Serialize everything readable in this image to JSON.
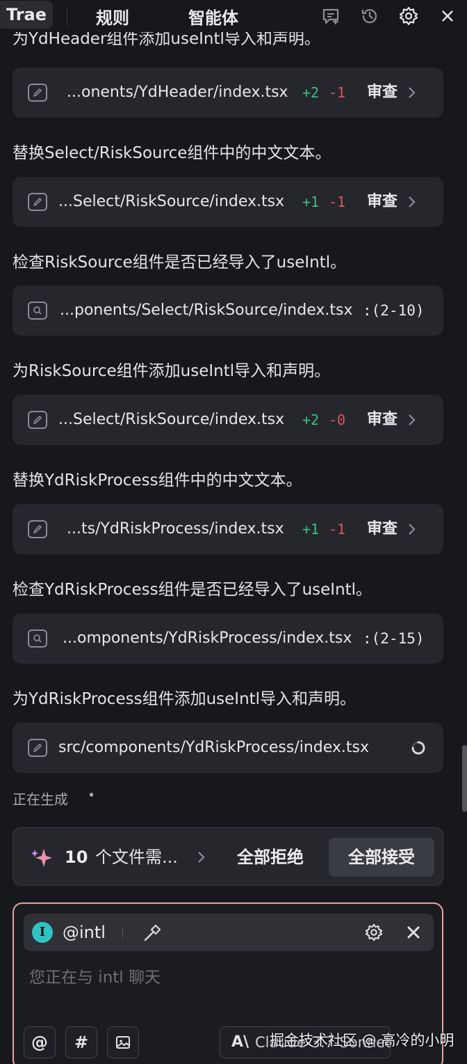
{
  "header": {
    "tabs": [
      {
        "label": "Trae"
      },
      {
        "label": "规则"
      },
      {
        "label": "智能体"
      }
    ]
  },
  "partial_desc": "为YdHeader组件添加useIntl导入和声明。",
  "items": [
    {
      "path": "...onents/YdHeader/index.tsx",
      "added": "+2",
      "removed": "-1",
      "review": "审查"
    },
    {
      "desc": "替换Select/RiskSource组件中的中文文本。"
    },
    {
      "path": "...Select/RiskSource/index.tsx",
      "added": "+1",
      "removed": "-1",
      "review": "审查"
    },
    {
      "desc": "检查RiskSource组件是否已经导入了useIntl。"
    },
    {
      "path": "...ponents/Select/RiskSource/index.tsx",
      "range": ":(2-10)"
    },
    {
      "desc": "为RiskSource组件添加useIntl导入和声明。"
    },
    {
      "path": "...Select/RiskSource/index.tsx",
      "added": "+2",
      "removed": "-0",
      "review": "审查"
    },
    {
      "desc": "替换YdRiskProcess组件中的中文文本。"
    },
    {
      "path": "...ts/YdRiskProcess/index.tsx",
      "added": "+1",
      "removed": "-1",
      "review": "审查"
    },
    {
      "desc": "检查YdRiskProcess组件是否已经导入了useIntl。"
    },
    {
      "path": "...omponents/YdRiskProcess/index.tsx",
      "range": ":(2-15)"
    },
    {
      "desc": "为YdRiskProcess组件添加useIntl导入和声明。"
    },
    {
      "path": "src/components/YdRiskProcess/index.tsx"
    }
  ],
  "status": {
    "generating": "正在生成",
    "dot": "•"
  },
  "action_bar": {
    "count": "10",
    "files_need": "个文件需...",
    "reject_all": "全部拒绝",
    "accept_all": "全部接受"
  },
  "chat": {
    "agent_badge": "I",
    "agent_name": "@intl",
    "placeholder": "您正在与 intl 聊天",
    "at_label": "@",
    "hash_label": "#",
    "model_icon": "A\\",
    "model_name": "Claude-3.7-Sonnet"
  },
  "watermark": "掘金技术社区 @ 高冷的小明",
  "colors": {
    "added": "#3fbf7f",
    "removed": "#e0565b",
    "agent_badge": "#2ec4c4",
    "input_border": "#e9a3a8"
  }
}
